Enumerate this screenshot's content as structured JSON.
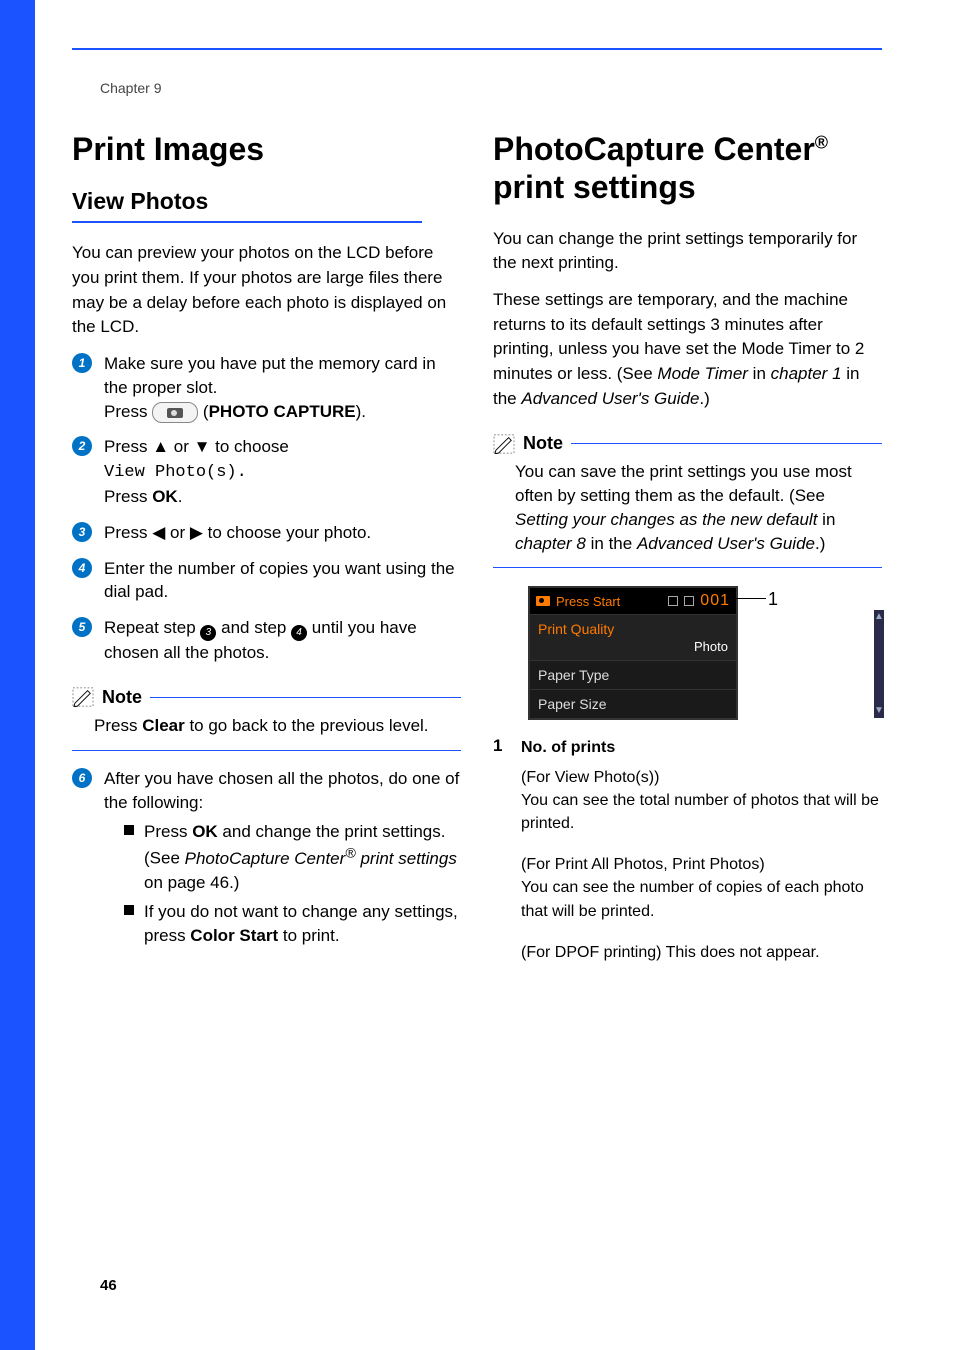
{
  "chapter": "Chapter 9",
  "page_number": "46",
  "left": {
    "h1": "Print Images",
    "h2": "View Photos",
    "intro": "You can preview your photos on the LCD before you print them. If your photos are large files there may be a delay before each photo is displayed on the LCD.",
    "step1a": "Make sure you have put the memory card in the proper slot.",
    "step1b_a": "Press ",
    "step1b_b": " (",
    "step1b_btn": "PHOTO CAPTURE",
    "step1b_c": ").",
    "step2a": "Press ",
    "step2b": " or ",
    "step2c": " to choose",
    "step2_mono": "View Photo(s).",
    "step2d_a": "Press ",
    "step2d_b": "OK",
    "step2d_c": ".",
    "step3a": "Press ",
    "step3b": " or ",
    "step3c": " to choose your photo.",
    "step4": "Enter the number of copies you want using the dial pad.",
    "step5a": "Repeat step ",
    "step5b": " and step ",
    "step5c": " until you have chosen all the photos.",
    "arrows": {
      "up": "▲",
      "down": "▼",
      "left": "◀",
      "right": "▶"
    },
    "note_label": "Note",
    "note_body_a": "Press ",
    "note_body_b": "Clear",
    "note_body_c": " to go back to the previous level.",
    "step6": "After you have chosen all the photos, do one of the following:",
    "bul1_a": "Press ",
    "bul1_b": "OK",
    "bul1_c": " and change the print settings. (See ",
    "bul1_d": "PhotoCapture Center",
    "bul1_e": " print settings",
    "bul1_f": " on page 46.)",
    "bul2_a": "If you do not want to change any settings, press ",
    "bul2_b": "Color Start",
    "bul2_c": " to print."
  },
  "right": {
    "h1_a": "PhotoCapture Center",
    "h1_b": " print settings",
    "p1": "You can change the print settings temporarily for the next printing.",
    "p2_a": "These settings are temporary, and the machine returns to its default settings 3 minutes after printing, unless you have set the Mode Timer to 2 minutes or less. (See ",
    "p2_b": "Mode Timer",
    "p2_c": " in ",
    "p2_d": "chapter 1",
    "p2_e": " in the ",
    "p2_f": "Advanced User's Guide",
    "p2_g": ".)",
    "note_label": "Note",
    "note_a": "You can save the print settings you use most often by setting them as the default. (See ",
    "note_b": "Setting your changes as the new default",
    "note_c": " in ",
    "note_d": "chapter 8",
    "note_e": " in the ",
    "note_f": "Advanced User's Guide",
    "note_g": ".)",
    "lcd": {
      "top_text": "Press Start",
      "num": "001",
      "row1_label": "Print Quality",
      "row1_val": "Photo",
      "row2": "Paper Type",
      "row3": "Paper Size"
    },
    "callout": "1",
    "legend_num": "1",
    "legend_title": "No. of prints",
    "legend1a": "(For View Photo(s))",
    "legend1b": "You can see the total number of photos that will be printed.",
    "legend2a": "(For Print All Photos, Print Photos)",
    "legend2b": "You can see the number of copies of each photo that will be printed.",
    "legend3": "(For DPOF printing) This does not appear."
  }
}
